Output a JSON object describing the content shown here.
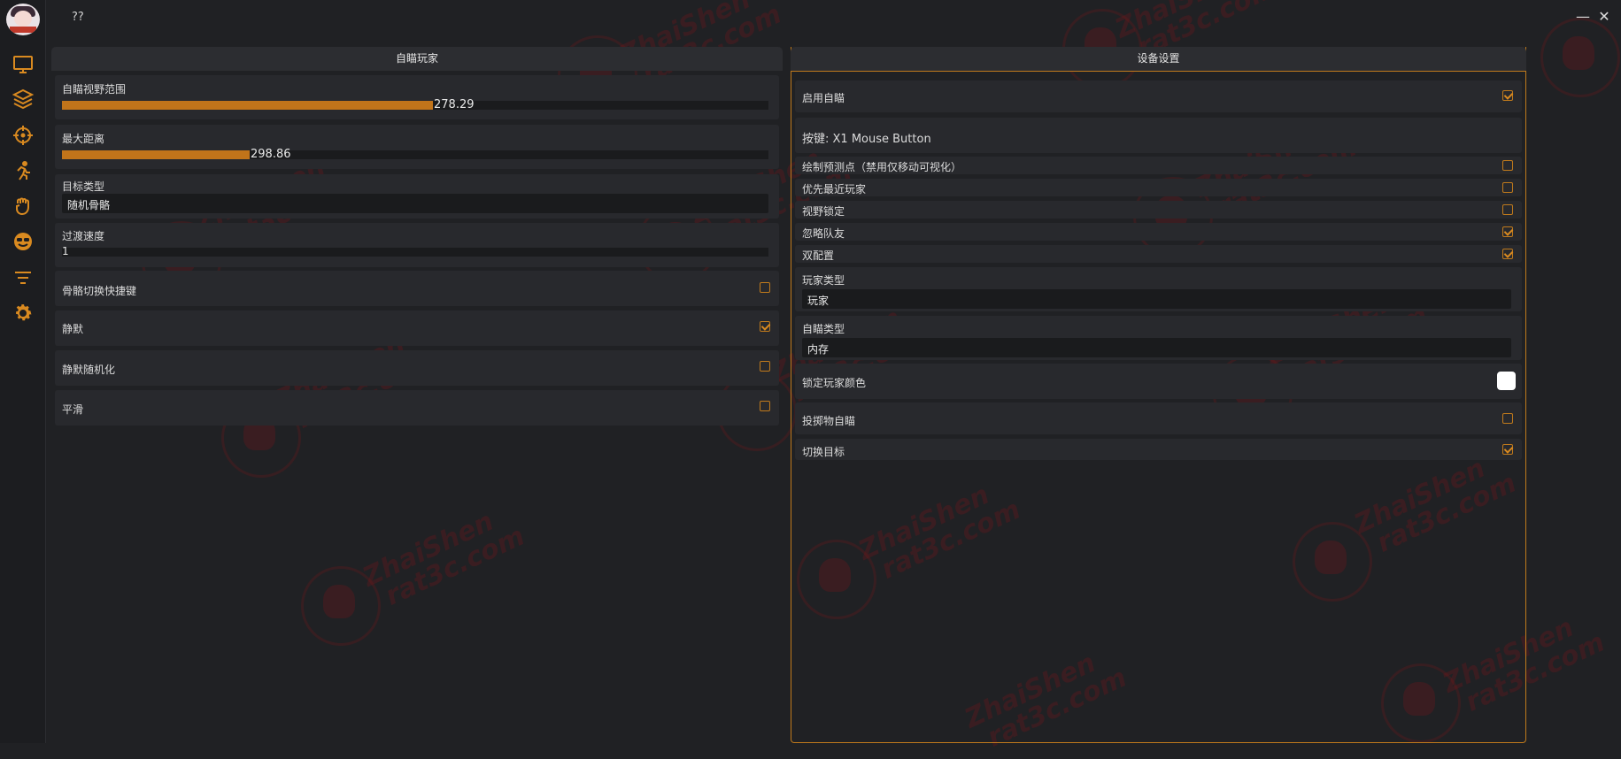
{
  "app": {
    "title": "??"
  },
  "window": {
    "minimize": "—",
    "close": "✕"
  },
  "sidebar": {
    "icons": [
      "monitor-icon",
      "layers-icon",
      "crosshair-icon",
      "running-person-icon",
      "fist-icon",
      "smiley-sunglasses-icon",
      "filter-lines-icon",
      "gear-icon"
    ],
    "accent": "#d98a20"
  },
  "left_panel": {
    "title": "自瞄玩家",
    "fov": {
      "label": "自瞄视野范围",
      "value": "278.29",
      "fill_fraction": 0.525
    },
    "max_distance": {
      "label": "最大距离",
      "value": "298.86",
      "fill_fraction": 0.266
    },
    "target_type": {
      "label": "目标类型",
      "selected": "随机骨骼"
    },
    "transition_speed": {
      "label": "过渡速度",
      "value": "1"
    },
    "bone_switch_hotkey": {
      "label": "骨骼切换快捷键",
      "checked": false
    },
    "silent": {
      "label": "静默",
      "checked": true
    },
    "silent_random": {
      "label": "静默随机化",
      "checked": false
    },
    "smooth": {
      "label": "平滑",
      "checked": false
    }
  },
  "right_panel": {
    "title": "设备设置",
    "enable_aim": {
      "label": "启用自瞄",
      "checked": true
    },
    "hotkey": {
      "label": "按键: X1 Mouse Button"
    },
    "draw_prediction": {
      "label": "绘制预测点（禁用仅移动可视化）",
      "checked": false
    },
    "prefer_nearest": {
      "label": "优先最近玩家",
      "checked": false
    },
    "fov_lock": {
      "label": "视野锁定",
      "checked": false
    },
    "ignore_team": {
      "label": "忽略队友",
      "checked": true
    },
    "dual_config": {
      "label": "双配置",
      "checked": true
    },
    "player_type": {
      "label": "玩家类型",
      "selected": "玩家"
    },
    "aim_type": {
      "label": "自瞄类型",
      "selected": "内存"
    },
    "lock_player_color": {
      "label": "锁定玩家颜色",
      "color": "#ffffff"
    },
    "projectile_aim": {
      "label": "投掷物自瞄",
      "checked": false
    },
    "switch_target": {
      "label": "切换目标",
      "checked": true
    }
  },
  "watermark": {
    "line1": "ZhaiShen",
    "line2": "rat3c.com"
  },
  "colors": {
    "background": "#202124",
    "panel_row": "#28292d",
    "accent": "#c07a1c",
    "slider": "#c1741a"
  }
}
